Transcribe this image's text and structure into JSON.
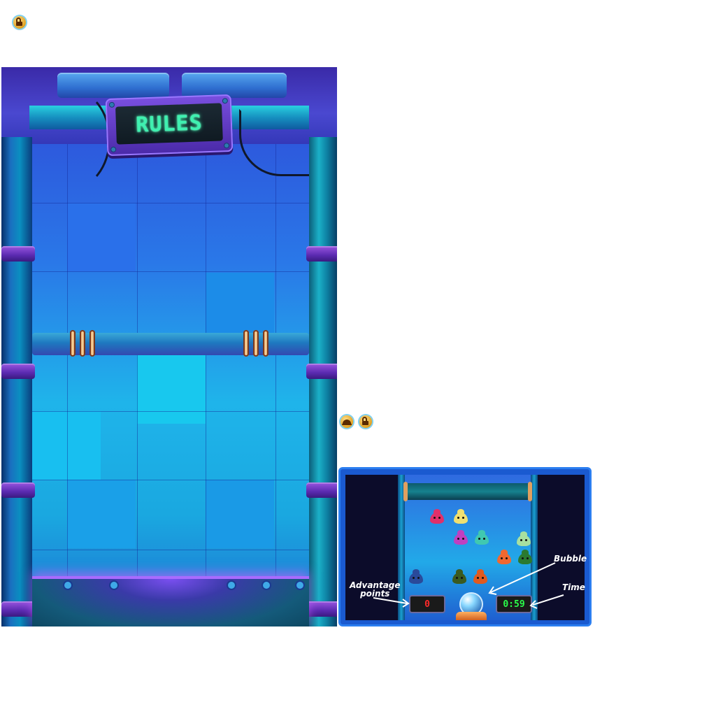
{
  "rules_screen": {
    "sign_text": "RULES"
  },
  "icons": {
    "top_lock": "lock-icon",
    "second_row": [
      "hat-icon",
      "lock-icon"
    ]
  },
  "preview": {
    "advantage_value": "0",
    "time_value": "0:59",
    "labels": {
      "advantage_line1": "Advantage",
      "advantage_line2": "points",
      "bubble": "Bubble",
      "time": "Time"
    }
  },
  "colors": {
    "sign_text": "#3ff0b0",
    "advantage_digits": "#ff2a2a",
    "time_digits": "#2aff4a",
    "panel_top": "#2f46d6",
    "panel_mid": "#1fb4ea"
  }
}
